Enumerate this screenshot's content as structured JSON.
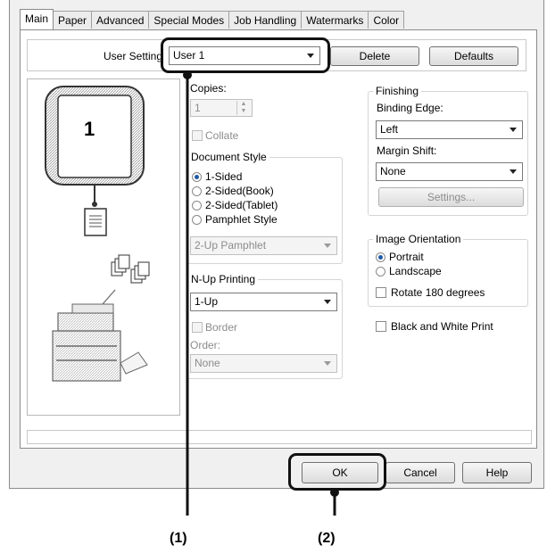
{
  "tabs": [
    "Main",
    "Paper",
    "Advanced",
    "Special Modes",
    "Job Handling",
    "Watermarks",
    "Color"
  ],
  "user_setting": {
    "label": "User Setting",
    "value": "User 1",
    "delete": "Delete",
    "defaults": "Defaults"
  },
  "preview": {
    "page_number": "1"
  },
  "copies": {
    "label": "Copies:",
    "value": "1",
    "collate": "Collate"
  },
  "document_style": {
    "label": "Document Style",
    "options": [
      "1-Sided",
      "2-Sided(Book)",
      "2-Sided(Tablet)",
      "Pamphlet Style"
    ],
    "selected": 0,
    "pamphlet_value": "2-Up Pamphlet"
  },
  "nup": {
    "label": "N-Up Printing",
    "value": "1-Up",
    "border": "Border",
    "order_label": "Order:",
    "order_value": "None"
  },
  "finishing": {
    "label": "Finishing",
    "binding_label": "Binding Edge:",
    "binding_value": "Left",
    "margin_label": "Margin Shift:",
    "margin_value": "None",
    "settings": "Settings..."
  },
  "orientation": {
    "label": "Image Orientation",
    "options": [
      "Portrait",
      "Landscape"
    ],
    "selected": 0,
    "rotate": "Rotate 180 degrees"
  },
  "black_white": "Black and White Print",
  "buttons": {
    "ok": "OK",
    "cancel": "Cancel",
    "help": "Help"
  },
  "callouts": {
    "one": "(1)",
    "two": "(2)"
  }
}
